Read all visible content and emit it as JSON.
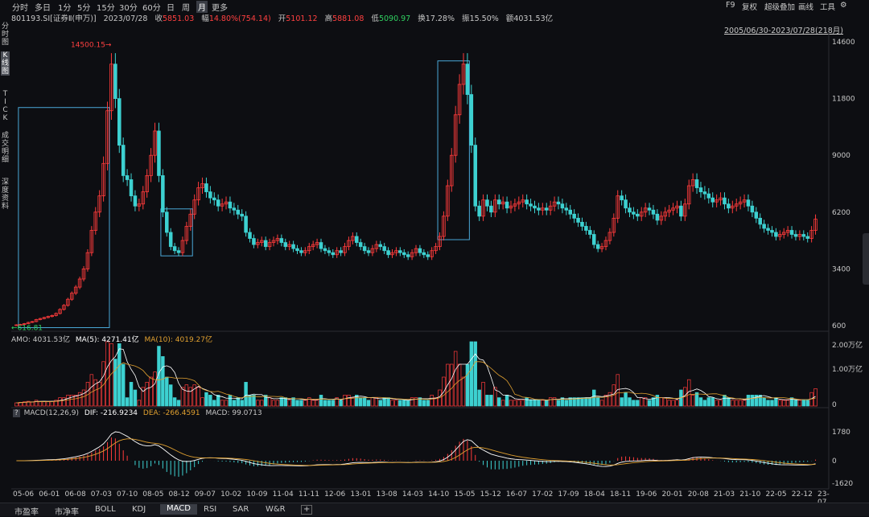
{
  "colors": {
    "bg": "#0d0e12",
    "up": "#ff3b3b",
    "down": "#3dd1d1",
    "ma5": "#ffffff",
    "ma10": "#e0a030",
    "box": "#4aa8d8",
    "text": "#c8c8c8",
    "red_text": "#ff4040",
    "green_text": "#30d060",
    "orange_text": "#e0a030"
  },
  "timeframes": [
    "分时",
    "多日",
    "1分",
    "5分",
    "15分",
    "30分",
    "60分",
    "日",
    "周",
    "月",
    "更多"
  ],
  "active_timeframe": "月",
  "top_right": [
    "F9",
    "复权",
    "超级叠加",
    "画线",
    "工具"
  ],
  "side_tabs": [
    {
      "label": "分时图",
      "active": false
    },
    {
      "label": "K线图",
      "active": true
    },
    {
      "label": "TICK",
      "active": false
    },
    {
      "label": "成交明细",
      "active": false
    },
    {
      "label": "深度资料",
      "active": false
    }
  ],
  "info": {
    "code": "801193.SI[证券Ⅱ(申万)]",
    "date": "2023/07/28",
    "close_label": "收",
    "close": "5851.03",
    "change_label": "幅",
    "change": "14.80%(754.14)",
    "open_label": "开",
    "open": "5101.12",
    "high_label": "高",
    "high": "5881.08",
    "low_label": "低",
    "low": "5090.97",
    "turnover_label": "换",
    "turnover": "17.28%",
    "amplitude_label": "振",
    "amplitude": "15.50%",
    "amount_label": "额",
    "amount": "4031.53亿"
  },
  "range_label": "2005/06/30-2023/07/28(218月)",
  "price_axis": [
    "14600",
    "11800",
    "9000",
    "6200",
    "3400",
    "600"
  ],
  "annotations": {
    "high_marker": "14500.15→",
    "low_marker": "←616.81"
  },
  "volume_panel": {
    "amo_label": "AMO: 4031.53亿",
    "ma5_label": "MA(5): 4271.41亿",
    "ma10_label": "MA(10): 4019.27亿",
    "axis": [
      "2.00万亿",
      "1.00万亿",
      "0"
    ]
  },
  "macd_panel": {
    "help": "?",
    "title": "MACD(12,26,9)",
    "dif": "DIF: -216.9234",
    "dea": "DEA: -266.4591",
    "macd": "MACD: 99.0713",
    "axis": [
      "1780",
      "0",
      "-1620"
    ]
  },
  "x_labels": [
    "05-06",
    "06-01",
    "06-08",
    "07-03",
    "07-10",
    "08-05",
    "08-12",
    "09-07",
    "10-02",
    "10-09",
    "11-04",
    "11-11",
    "12-06",
    "13-01",
    "13-08",
    "14-03",
    "14-10",
    "15-05",
    "15-12",
    "16-07",
    "17-02",
    "17-09",
    "18-04",
    "18-11",
    "19-06",
    "20-01",
    "20-08",
    "21-03",
    "21-10",
    "22-05",
    "22-12",
    "23-07"
  ],
  "bottom_tabs": [
    "市盈率",
    "市净率",
    "BOLL",
    "KDJ",
    "MACD",
    "RSI",
    "SAR",
    "W&R",
    "+"
  ],
  "active_bottom_tab": "MACD",
  "chart_data": {
    "type": "candlestick",
    "description_period": "monthly",
    "ylim": [
      600,
      14600
    ],
    "close_series": [
      640,
      660,
      700,
      760,
      800,
      900,
      950,
      1000,
      1050,
      1100,
      1200,
      1400,
      1600,
      1900,
      2200,
      2500,
      2900,
      3400,
      4200,
      5300,
      6200,
      7000,
      8600,
      11200,
      13500,
      11800,
      9500,
      8000,
      7800,
      7000,
      6500,
      6600,
      7200,
      8000,
      9000,
      10200,
      8000,
      6200,
      5200,
      4500,
      4300,
      4200,
      4800,
      5500,
      6100,
      6800,
      7400,
      7600,
      7200,
      6900,
      6800,
      6500,
      6600,
      6700,
      6400,
      6300,
      6100,
      6000,
      5200,
      4900,
      4600,
      4700,
      4800,
      4500,
      4700,
      4800,
      4900,
      4700,
      4500,
      4600,
      4400,
      4300,
      4200,
      4300,
      4500,
      4600,
      4700,
      4400,
      4300,
      4200,
      4100,
      4300,
      4200,
      4500,
      4800,
      5000,
      4700,
      4500,
      4300,
      4200,
      4400,
      4600,
      4500,
      4300,
      4100,
      4200,
      4300,
      4200,
      4100,
      4000,
      4200,
      4400,
      4200,
      4100,
      4000,
      4300,
      4500,
      5000,
      6000,
      7500,
      9000,
      11000,
      12500,
      13500,
      12000,
      9500,
      6500,
      6000,
      6800,
      6500,
      6200,
      6800,
      6600,
      6700,
      6400,
      6500,
      6600,
      6700,
      6800,
      6600,
      6500,
      6400,
      6300,
      6400,
      6300,
      6500,
      6700,
      6600,
      6400,
      6300,
      6100,
      5900,
      5700,
      5500,
      5300,
      5100,
      4600,
      4400,
      4500,
      4800,
      5200,
      5900,
      7000,
      6800,
      6400,
      6200,
      6100,
      6000,
      6200,
      6400,
      6300,
      6100,
      5800,
      6000,
      6200,
      6300,
      6400,
      6500,
      6000,
      6600,
      7500,
      7800,
      7400,
      7200,
      7100,
      6900,
      6700,
      6800,
      6900,
      6600,
      6400,
      6500,
      6600,
      6700,
      6800,
      6500,
      6200,
      5900,
      5600,
      5400,
      5300,
      5200,
      5000,
      5100,
      5200,
      5300,
      5100,
      5000,
      5100,
      5000,
      4900,
      5300,
      5851.03
    ],
    "boxes": [
      [
        1,
        23
      ],
      [
        37,
        44
      ],
      [
        107,
        114
      ]
    ],
    "macd_line_peak": 1780,
    "macd_min": -1620
  }
}
